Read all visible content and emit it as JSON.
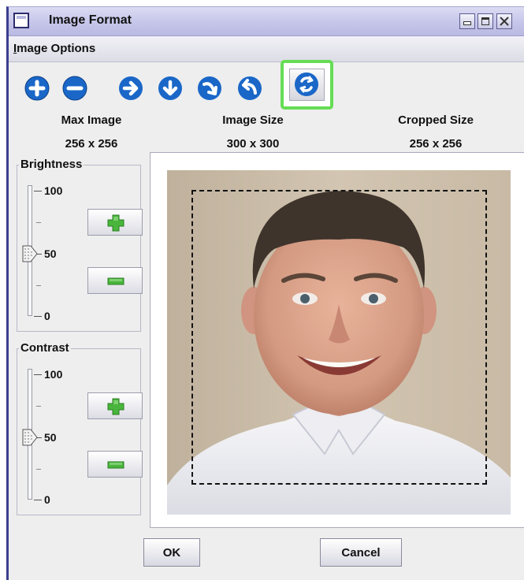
{
  "window": {
    "title": "Image Format"
  },
  "menu": {
    "image_options_prefix": "I",
    "image_options_rest": "mage Options"
  },
  "toolbar": {
    "icons": [
      "zoom-in-icon",
      "zoom-out-icon",
      "move-right-icon",
      "move-down-icon",
      "rotate-right-icon",
      "rotate-left-icon",
      "rotate-icon"
    ],
    "selected": "rotate-icon",
    "highlight_color": "#66dd55",
    "icon_color": "#1a67c8"
  },
  "sizes": {
    "max_image_label": "Max Image",
    "max_image_value": "256 x 256",
    "image_size_label": "Image Size",
    "image_size_value": "300 x 300",
    "cropped_size_label": "Cropped Size",
    "cropped_size_value": "256 x 256"
  },
  "brightness": {
    "label": "Brightness",
    "tick_max": "100",
    "tick_mid": "50",
    "tick_min": "0",
    "value": 50
  },
  "contrast": {
    "label": "Contrast",
    "tick_max": "100",
    "tick_mid": "50",
    "tick_min": "0",
    "value": 50
  },
  "buttons": {
    "ok": "OK",
    "cancel": "Cancel"
  }
}
